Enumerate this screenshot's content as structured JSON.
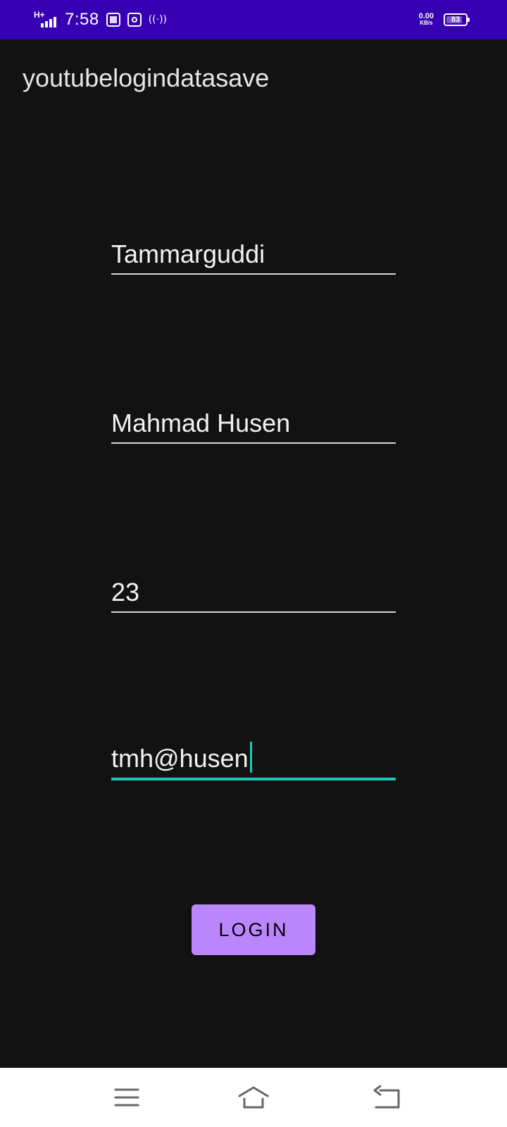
{
  "status_bar": {
    "network": "H+",
    "time": "7:58",
    "speed_value": "0.00",
    "speed_unit": "KB/s",
    "battery": "83",
    "battery_level": 0.83
  },
  "app_bar": {
    "title": "youtubelogindatasave"
  },
  "form": {
    "fields": [
      {
        "value": "Tammarguddi"
      },
      {
        "value": "Mahmad Husen"
      },
      {
        "value": "23"
      },
      {
        "value": "tmh@husen"
      }
    ],
    "login_label": "LOGIN"
  },
  "colors": {
    "status_bar": "#3700B3",
    "background": "#121212",
    "accent": "#1FC7B5",
    "button": "#BB86FC"
  },
  "nav_bar": {
    "icons": [
      "menu-icon",
      "home-icon",
      "back-icon"
    ]
  }
}
